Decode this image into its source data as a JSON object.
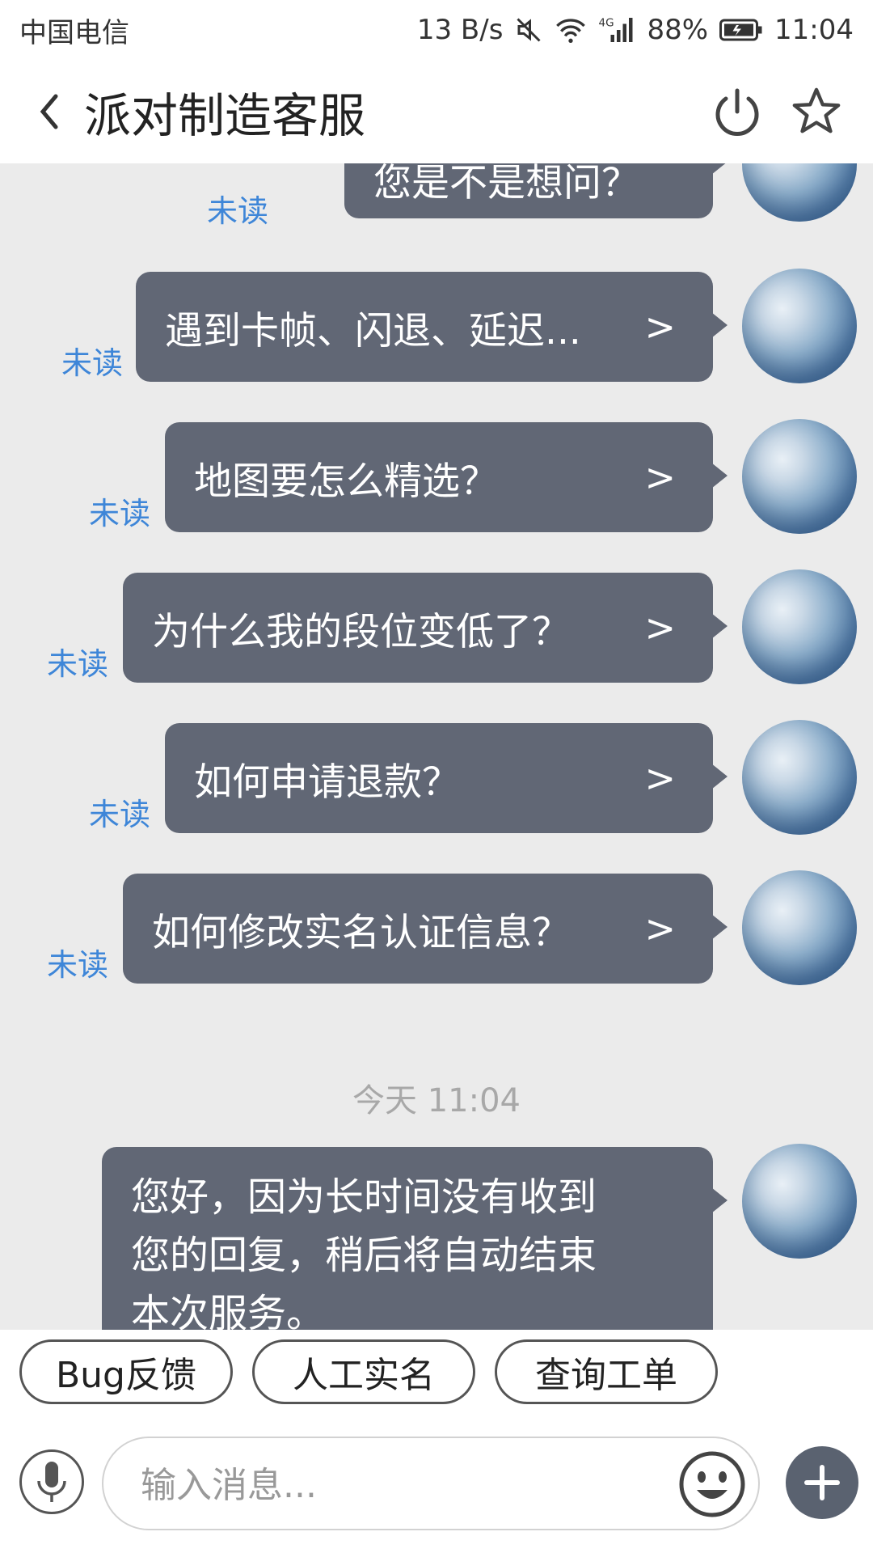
{
  "status_bar": {
    "carrier": "中国电信",
    "network_speed": "13 B/s",
    "battery": "88%",
    "time": "11:04",
    "icons": [
      "mute-icon",
      "wifi-icon",
      "4g-signal-icon",
      "battery-icon"
    ]
  },
  "header": {
    "title": "派对制造客服",
    "back_icon": "chevron-left-icon",
    "power_icon": "power-icon",
    "favorite_icon": "star-icon"
  },
  "chat": {
    "unread_label": "未读",
    "messages": [
      {
        "text": "您是不是想问？",
        "arrow": ""
      },
      {
        "text": "遇到卡帧、闪退、延迟...",
        "arrow": ">"
      },
      {
        "text": "地图要怎么精选？",
        "arrow": ">"
      },
      {
        "text": "为什么我的段位变低了？",
        "arrow": ">"
      },
      {
        "text": "如何申请退款？",
        "arrow": ">"
      },
      {
        "text": "如何修改实名认证信息？",
        "arrow": ">"
      }
    ],
    "timestamp": "今天 11:04",
    "last_message_lines": [
      "您好，因为长时间没有收到",
      "您的回复，稍后将自动结束",
      "本次服务。"
    ]
  },
  "quick_replies": [
    "Bug反馈",
    "人工实名",
    "查询工单"
  ],
  "input": {
    "placeholder": "输入消息...",
    "value": ""
  },
  "colors": {
    "bubble": "#616775",
    "unread": "#3e86d8",
    "background": "#ebebeb"
  }
}
